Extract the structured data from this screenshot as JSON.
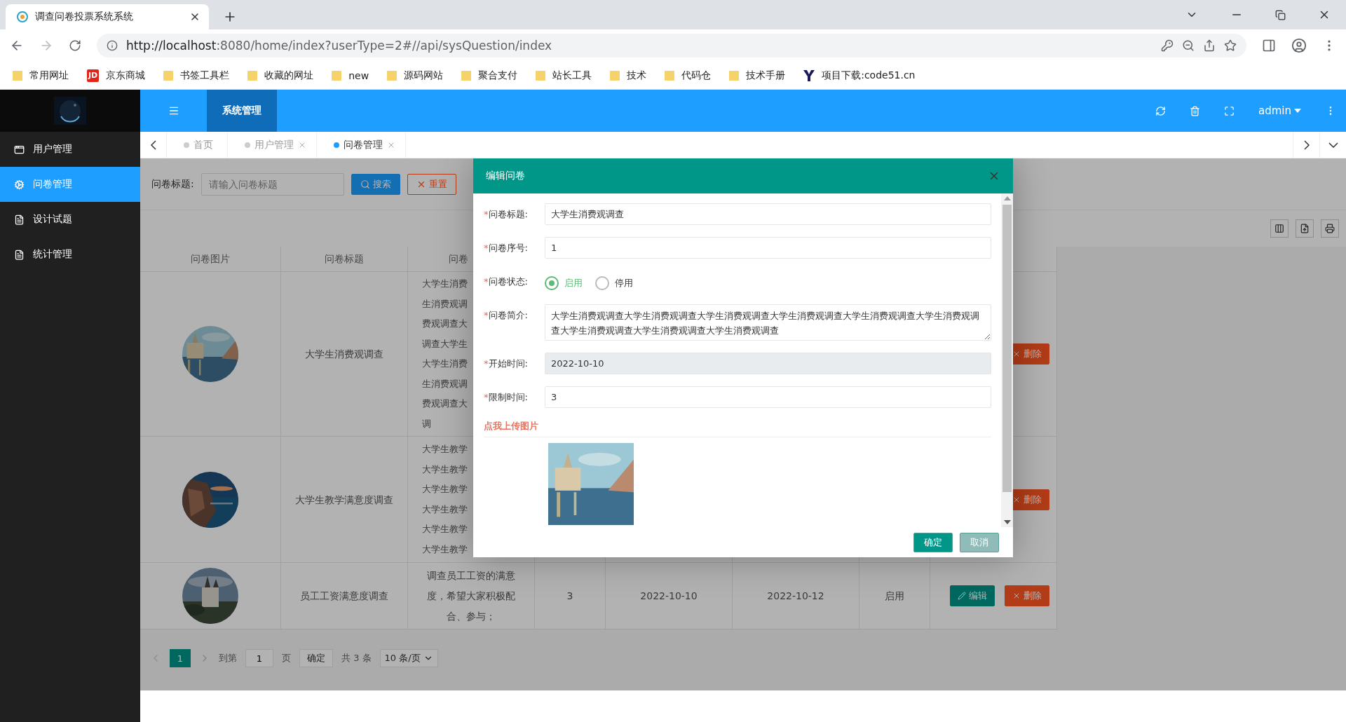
{
  "browser": {
    "tab_title": "调查问卷投票系统系统",
    "url_host": "http://localhost",
    "url_rest": ":8080/home/index?userType=2#//api/sysQuestion/index",
    "bookmarks": [
      {
        "label": "常用网址",
        "kind": "folder"
      },
      {
        "label": "京东商城",
        "kind": "badge",
        "badge": "JD"
      },
      {
        "label": "书签工具栏",
        "kind": "folder"
      },
      {
        "label": "收藏的网址",
        "kind": "folder"
      },
      {
        "label": "new",
        "kind": "folder"
      },
      {
        "label": "源码网站",
        "kind": "folder"
      },
      {
        "label": "聚合支付",
        "kind": "folder"
      },
      {
        "label": "站长工具",
        "kind": "folder"
      },
      {
        "label": "技术",
        "kind": "folder"
      },
      {
        "label": "代码仓",
        "kind": "folder"
      },
      {
        "label": "技术手册",
        "kind": "folder"
      },
      {
        "label": "项目下载:code51.cn",
        "kind": "site"
      }
    ]
  },
  "header": {
    "menu_tab": "系统管理",
    "user": "admin"
  },
  "sidebar": {
    "items": [
      {
        "label": "用户管理",
        "kind": "window",
        "selected": false
      },
      {
        "label": "问卷管理",
        "kind": "gears",
        "selected": true
      },
      {
        "label": "设计试题",
        "kind": "file",
        "selected": false
      },
      {
        "label": "统计管理",
        "kind": "file",
        "selected": false
      }
    ]
  },
  "page_tabs": [
    {
      "label": "首页",
      "selected": false,
      "closable": false
    },
    {
      "label": "用户管理",
      "selected": false,
      "closable": true
    },
    {
      "label": "问卷管理",
      "selected": true,
      "closable": true
    }
  ],
  "search": {
    "label": "问卷标题:",
    "placeholder": "请输入问卷标题",
    "search_button": "搜索",
    "reset_button": "重置"
  },
  "table": {
    "columns": [
      "问卷图片",
      "问卷标题",
      "问卷"
    ],
    "rows": [
      {
        "title": "大学生消费观调查",
        "intro_lines": [
          "大学生消费",
          "生消费观调",
          "费观调查大",
          "调查大学生",
          "大学生消费",
          "生消费观调",
          "费观调查大",
          "调"
        ],
        "delete": "删除"
      },
      {
        "title": "大学生教学满意度调查",
        "intro_lines": [
          "大学生教学",
          "大学生教学",
          "大学生教学",
          "大学生教学",
          "大学生教学",
          "大学生教学"
        ],
        "delete": "删除"
      },
      {
        "title": "员工工资满意度调查",
        "intro": "调查员工工资的满意度，希望大家积极配合、参与；",
        "number": "3",
        "start": "2022-10-10",
        "end": "2022-10-12",
        "status": "启用",
        "edit": "编辑",
        "delete": "删除"
      }
    ]
  },
  "pagination": {
    "current": "1",
    "goto_label": "到第",
    "goto_value": "1",
    "page_label": "页",
    "confirm": "确定",
    "total": "共 3 条",
    "page_size": "10 条/页"
  },
  "dialog": {
    "title": "编辑问卷",
    "fields": [
      {
        "label": "问卷标题:",
        "mark": "*",
        "kind": "text",
        "value": "大学生消费观调查",
        "disabled": false
      },
      {
        "label": "问卷序号:",
        "mark": "*",
        "kind": "text",
        "value": "1",
        "disabled": false
      },
      {
        "label": "问卷状态:",
        "mark": "*",
        "kind": "radio",
        "options": [
          {
            "label": "启用",
            "selected": true
          },
          {
            "label": "停用",
            "selected": false
          }
        ]
      },
      {
        "label": "问卷简介:",
        "mark": "*",
        "kind": "textarea",
        "value": "大学生消费观调查大学生消费观调查大学生消费观调查大学生消费观调查大学生消费观调查大学生消费观调查大学生消费观调查大学生消费观调查大学生消费观调查"
      },
      {
        "label": "开始时间:",
        "mark": "*",
        "kind": "text",
        "value": "2022-10-10",
        "disabled": true
      },
      {
        "label": "限制时间:",
        "mark": "*",
        "kind": "text",
        "value": "3",
        "disabled": false
      }
    ],
    "upload_label": "点我上传图片",
    "confirm": "确定",
    "cancel": "取消"
  }
}
